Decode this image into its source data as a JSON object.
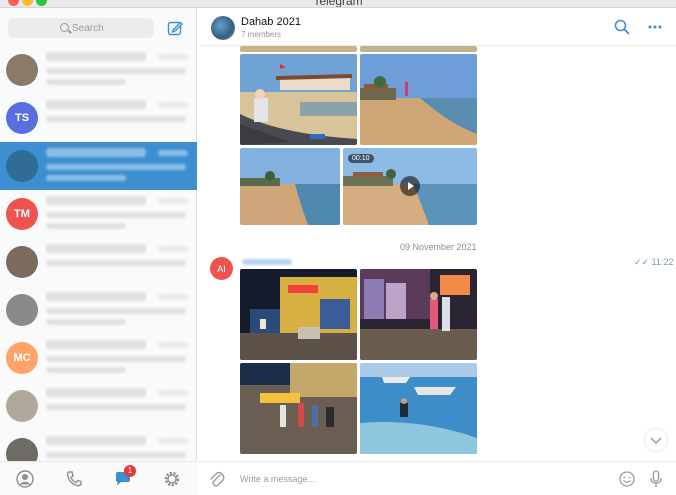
{
  "window": {
    "title": "Telegram"
  },
  "sidebar": {
    "search_placeholder": "Search",
    "chats": [
      {
        "avatar_color": "#8a7a6a",
        "avatar_text": "",
        "active": false
      },
      {
        "avatar_color": "#5b6ee1",
        "avatar_text": "TS",
        "active": false
      },
      {
        "avatar_color": "#2f6c96",
        "avatar_text": "",
        "active": true
      },
      {
        "avatar_color": "#ef5350",
        "avatar_text": "ТМ",
        "active": false
      },
      {
        "avatar_color": "#7c6a5c",
        "avatar_text": "",
        "active": false
      },
      {
        "avatar_color": "#8a8a8a",
        "avatar_text": "",
        "active": false
      },
      {
        "avatar_color": "#ffa36b",
        "avatar_text": "МС",
        "active": false
      },
      {
        "avatar_color": "#b0a99b",
        "avatar_text": "",
        "active": false
      },
      {
        "avatar_color": "#6e6a64",
        "avatar_text": "",
        "active": false
      }
    ],
    "bottom": {
      "badge_count": "1"
    }
  },
  "chat": {
    "title": "Dahab 2021",
    "subtitle": "7 members",
    "date_separator": "09 November 2021",
    "sender_initials": "AI",
    "message_time": "11:22",
    "video_duration": "00:10",
    "composer_placeholder": "Write a message..."
  },
  "colors": {
    "accent": "#3d8fd0",
    "badge": "#e53935"
  }
}
